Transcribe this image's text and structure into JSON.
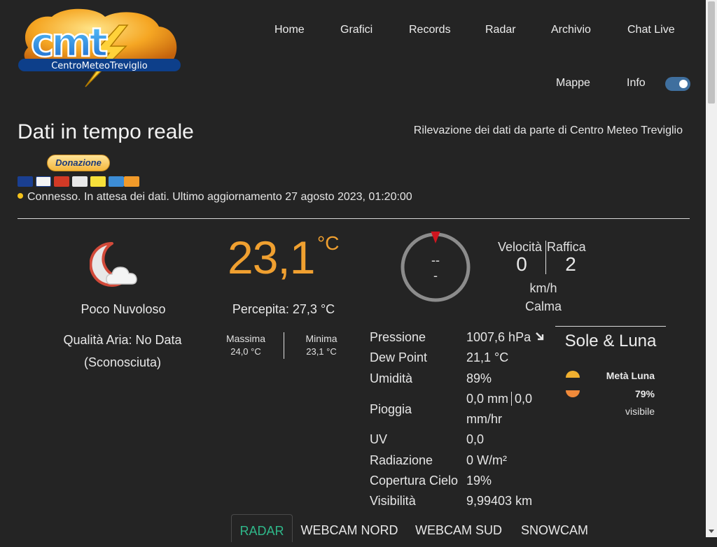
{
  "logo": {
    "text": "CentroMeteoTreviglio",
    "big_letters": "cmt"
  },
  "nav": {
    "items": [
      "Home",
      "Grafici",
      "Records",
      "Radar",
      "Archivio",
      "Chat Live"
    ],
    "items_row2": [
      "Mappe",
      "Info"
    ],
    "theme_toggle": "on"
  },
  "header": {
    "title": "Dati in tempo reale",
    "subtitle": "Rilevazione dei dati da parte di Centro Meteo Treviglio"
  },
  "donate": {
    "label": "Donazione",
    "cards": [
      "maestro",
      "visa",
      "mastercard",
      "paypal",
      "postepay",
      "amex",
      "discover"
    ]
  },
  "status": {
    "dot_color": "#f4c21b",
    "text": "Connesso. In attesa dei dati. Ultimo aggiornamento 27 agosto 2023, 01:20:00"
  },
  "conditions": {
    "icon": "moon-cloud-icon",
    "label": "Poco Nuvoloso",
    "air_quality": "Qualità Aria: No Data",
    "air_quality_sub": "(Sconosciuta)"
  },
  "temperature": {
    "value": "23,1",
    "unit": "°C",
    "feels_like": "Percepita: 27,3 °C",
    "max_label": "Massima",
    "max_value": "24,0 °C",
    "min_label": "Minima",
    "min_value": "23,1 °C",
    "color": "#f0a030"
  },
  "wind": {
    "direction_line1": "--",
    "direction_line2": "-",
    "speed_label": "Velocità",
    "gust_label": "Raffica",
    "speed": "0",
    "gust": "2",
    "unit": "km/h",
    "description": "Calma"
  },
  "readings": [
    {
      "label": "Pressione",
      "value": "1007,6 hPa"
    },
    {
      "label": "Dew Point",
      "value": "21,1 °C"
    },
    {
      "label": "Umidità",
      "value": "89%"
    },
    {
      "label": "Pioggia",
      "value": "0,0 mm",
      "value2": "0,0",
      "value3": "mm/hr"
    },
    {
      "label": "UV",
      "value": "0,0"
    },
    {
      "label": "Radiazione",
      "value": "0 W/m²"
    },
    {
      "label": "Copertura Cielo",
      "value": "19%"
    },
    {
      "label": "Visibilità",
      "value": "9,99403 km"
    }
  ],
  "sun_moon": {
    "title": "Sole & Luna",
    "phase": "Metà Luna",
    "percent": "79%",
    "visible_label": "visibile"
  },
  "tabs": [
    {
      "label": "RADAR",
      "active": true
    },
    {
      "label": "WEBCAM NORD",
      "active": false
    },
    {
      "label": "WEBCAM SUD",
      "active": false
    },
    {
      "label": "SNOWCAM",
      "active": false
    }
  ]
}
